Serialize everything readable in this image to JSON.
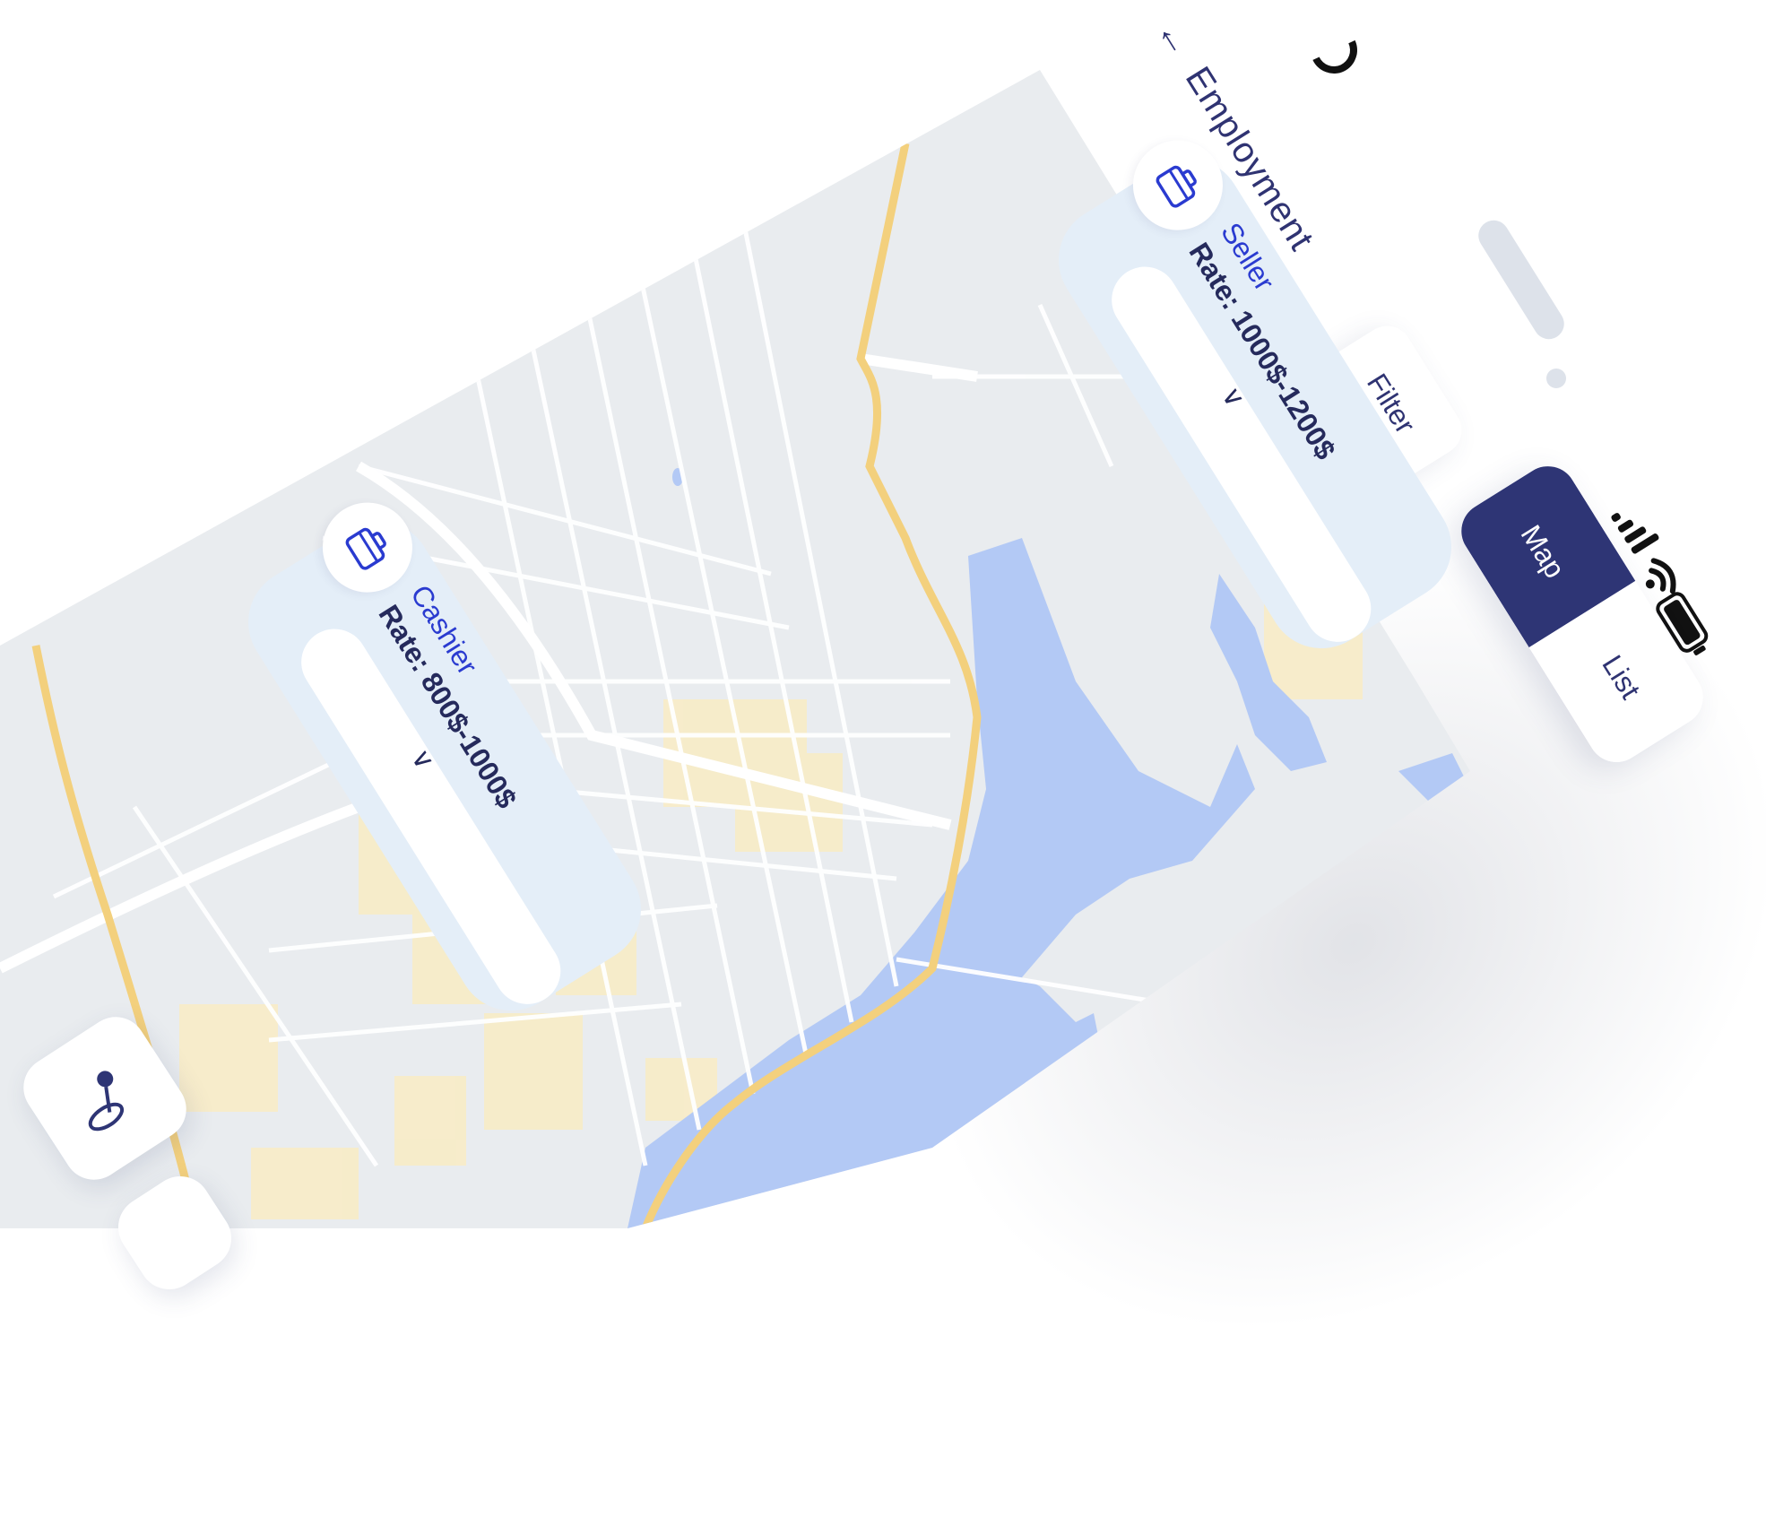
{
  "header": {
    "back_label": "Employment"
  },
  "status_bar": {
    "signal_icon": "signal-bars-icon",
    "wifi_icon": "wifi-icon",
    "battery_icon": "battery-icon"
  },
  "toolbar": {
    "filter_label": "Filter",
    "view_tabs": [
      {
        "label": "Map",
        "selected": true
      },
      {
        "label": "List",
        "selected": false
      }
    ]
  },
  "map_markers": [
    {
      "role": "Seller",
      "rate": "Rate: 1000$-1200$",
      "icon": "briefcase-icon"
    },
    {
      "role": "Cashier",
      "rate": "Rate: 800$-1000$",
      "icon": "briefcase-icon"
    }
  ],
  "colors": {
    "accent": "#2e3575",
    "title": "#2f3372",
    "role": "#2a3bd0",
    "card_bg": "#e4eef8",
    "map_land": "#e9ecef",
    "map_water": "#b3c9f5",
    "map_highway": "#f3d07d",
    "map_urban": "#f8ecc6"
  },
  "fab": {
    "icon": "location-pin-icon"
  }
}
